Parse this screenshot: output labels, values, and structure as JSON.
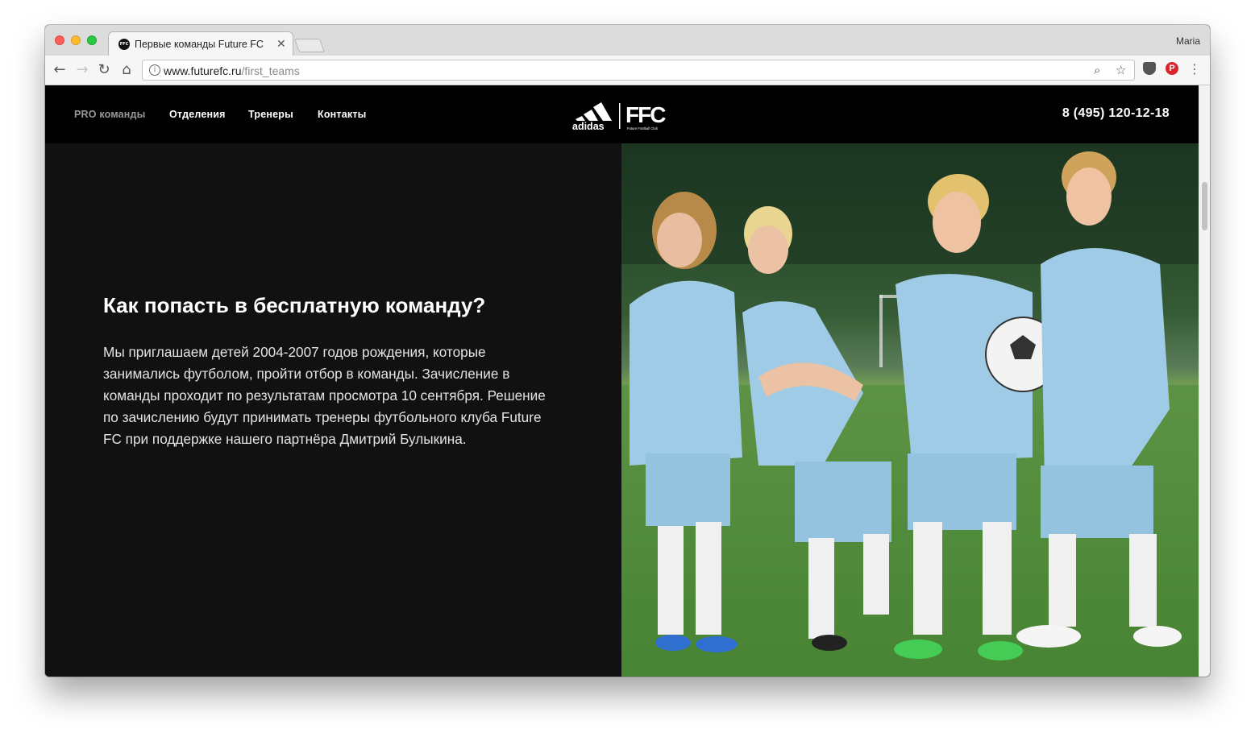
{
  "browser": {
    "tab_title": "Первые команды Future FC",
    "tab_favicon": "FFC",
    "profile_name": "Maria",
    "url_host": "www.futurefc.ru",
    "url_path": "/first_teams",
    "icons": [
      "back-icon",
      "forward-icon",
      "reload-icon",
      "home-icon",
      "info-icon",
      "zoom-icon",
      "star-icon",
      "pocket-icon",
      "pinterest-icon",
      "menu-icon"
    ]
  },
  "site": {
    "nav": [
      {
        "label": "PRO команды",
        "active": true
      },
      {
        "label": "Отделения"
      },
      {
        "label": "Тренеры"
      },
      {
        "label": "Контакты"
      }
    ],
    "logo": {
      "brand": "adidas",
      "club": "FFC",
      "club_sub": "Future Football Club"
    },
    "phone": "8 (495) 120-12-18"
  },
  "main": {
    "heading": "Как попасть в бесплатную команду?",
    "body": "Мы приглашаем детей 2004-2007 годов рождения, которые занимались футболом, пройти отбор в команды. Зачисление в команды проходит по результатам просмотра 10 сентября. Решение по зачислению будут принимать тренеры футбольного клуба Future FC при поддержке нашего партнёра Дмитрий Булыкина."
  },
  "colors": {
    "header_bg": "#000000",
    "content_bg": "#111111",
    "jersey": "#9fcbe6",
    "grass": "#4f8d3a"
  }
}
